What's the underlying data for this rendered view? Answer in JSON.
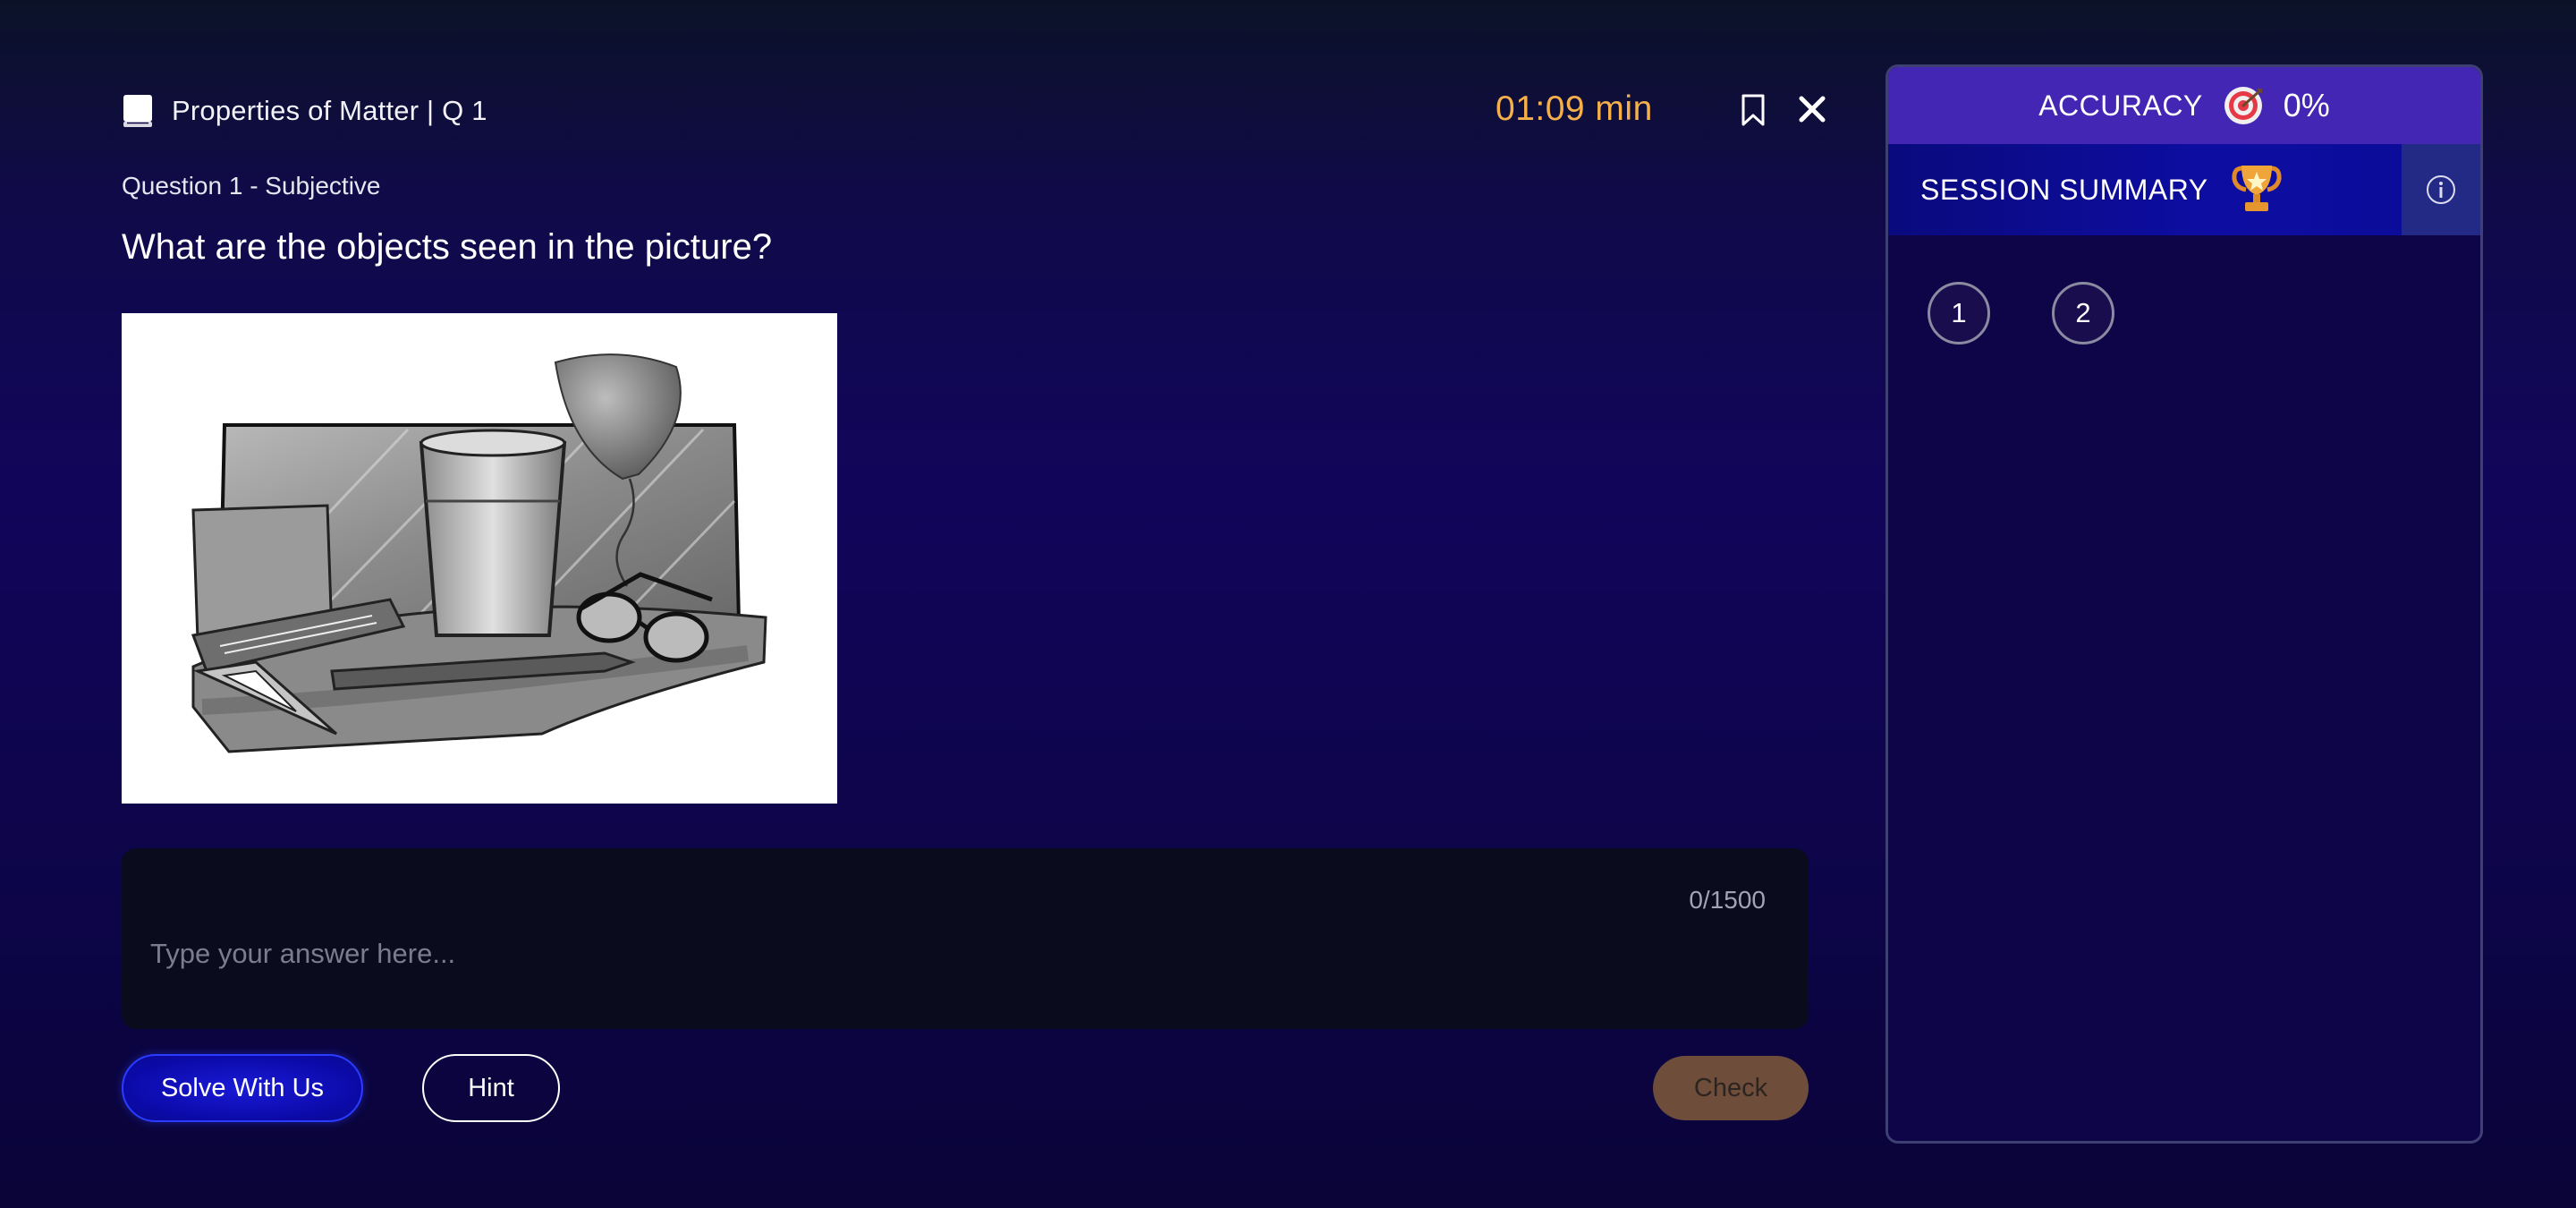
{
  "header": {
    "topic_title": "Properties of Matter | Q 1",
    "timer": "01:09 min",
    "icons": {
      "topic": "book-icon",
      "bookmark": "bookmark-icon",
      "close": "close-icon"
    }
  },
  "question": {
    "subtitle": "Question 1 - Subjective",
    "text": "What are the objects seen in the picture?"
  },
  "answer": {
    "placeholder": "Type your answer here...",
    "value": "",
    "char_count": "0/1500"
  },
  "buttons": {
    "solve_with_us": "Solve With Us",
    "hint": "Hint",
    "check": "Check"
  },
  "panel": {
    "accuracy_label": "ACCURACY",
    "accuracy_value": "0%",
    "summary_label": "SESSION SUMMARY",
    "question_numbers": [
      "1",
      "2"
    ],
    "icons": {
      "accuracy": "target-icon",
      "summary": "trophy-icon",
      "info": "info-icon"
    }
  },
  "colors": {
    "timer": "#f5b04c",
    "accuracy_bar": "#4426b4",
    "summary_bar": "#0d0da2",
    "solve_button": "#1a1ad8",
    "check_button": "#6e4e3a",
    "answer_box": "#0a0b1c"
  }
}
